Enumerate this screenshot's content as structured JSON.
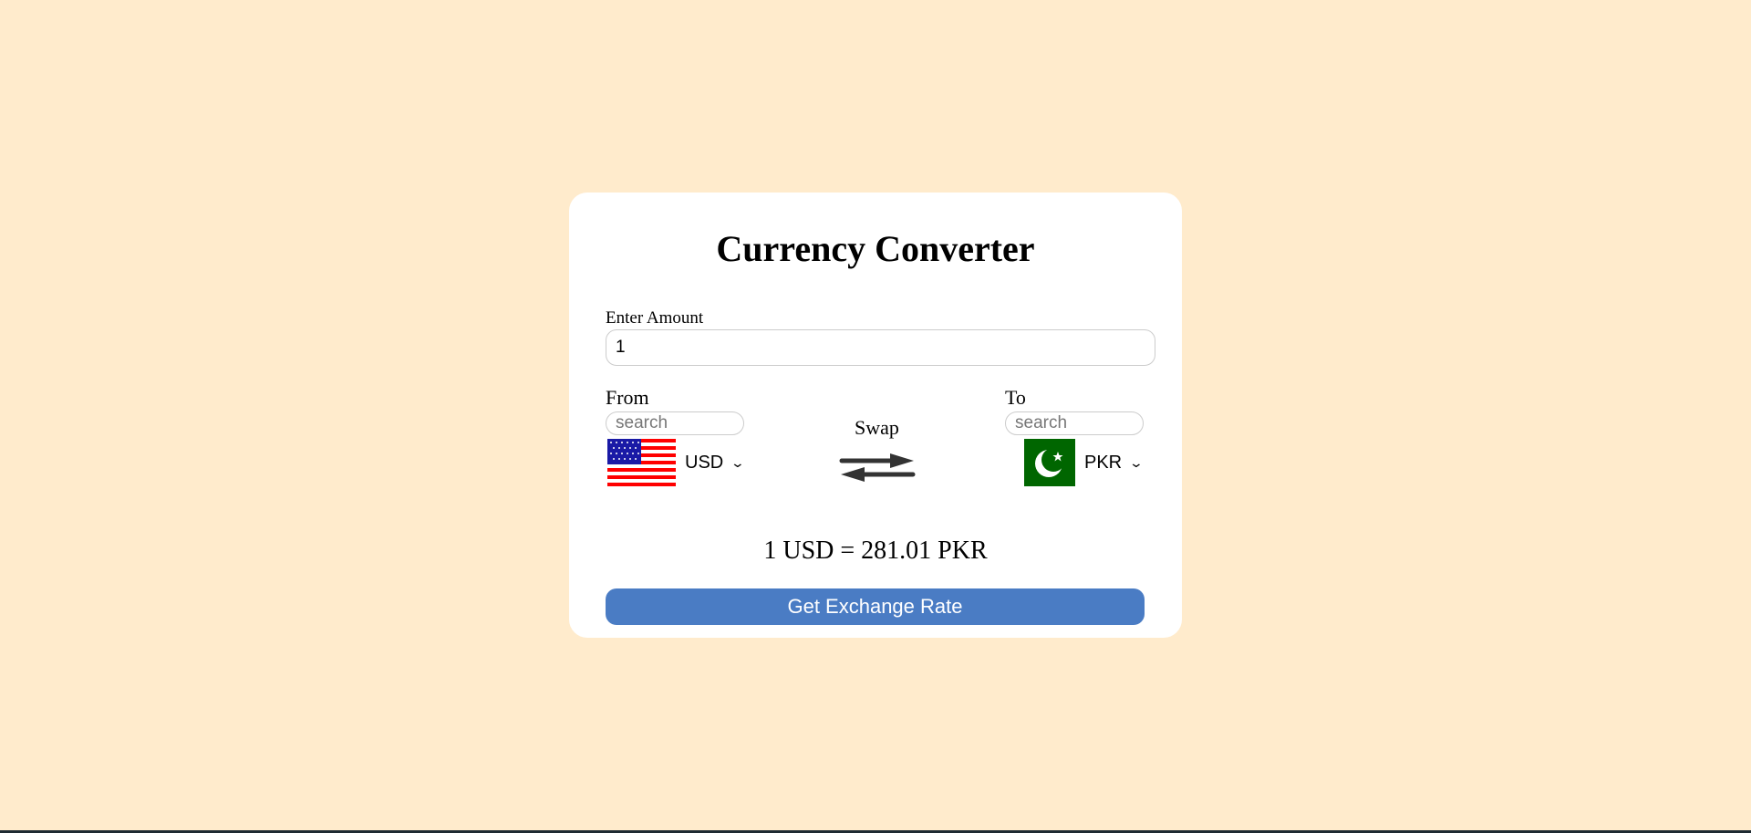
{
  "title": "Currency Converter",
  "amount": {
    "label": "Enter Amount",
    "value": "1"
  },
  "from": {
    "label": "From",
    "search_placeholder": "search",
    "currency": "USD",
    "flag": "us-flag-icon"
  },
  "to": {
    "label": "To",
    "search_placeholder": "search",
    "currency": "PKR",
    "flag": "pk-flag-icon"
  },
  "swap": {
    "label": "Swap",
    "icon": "swap-arrows-icon"
  },
  "result": "1 USD = 281.01 PKR",
  "button_label": "Get Exchange Rate",
  "colors": {
    "background": "#ffebcc",
    "button": "#4a7cc4",
    "card": "#ffffff"
  }
}
